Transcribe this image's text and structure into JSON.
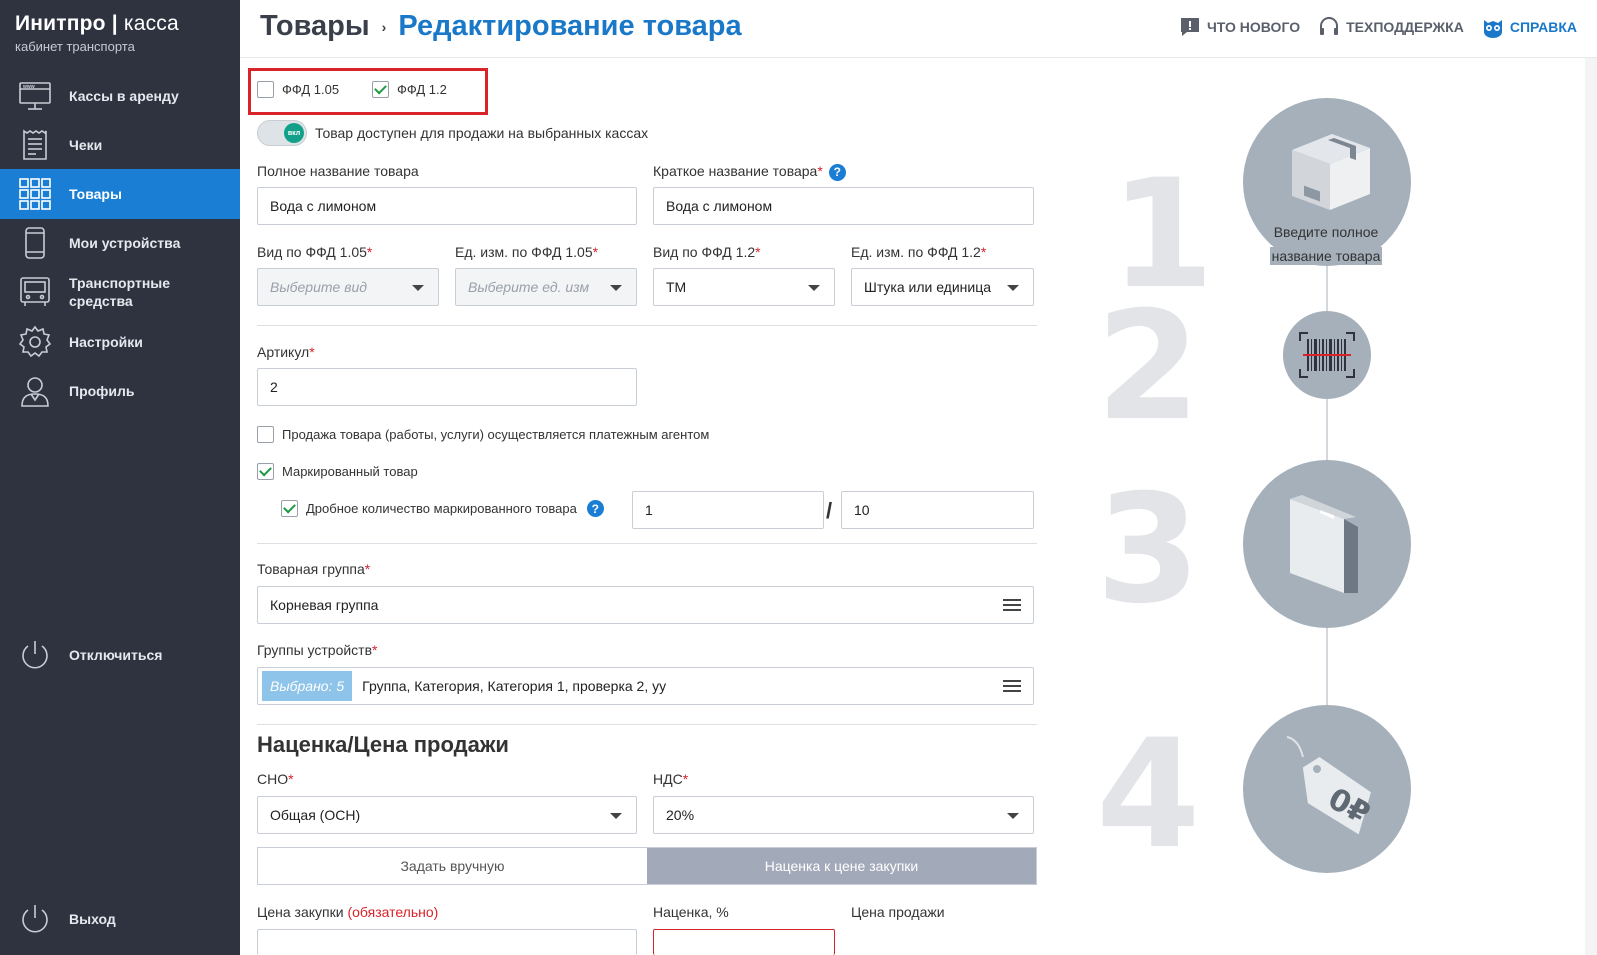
{
  "app": {
    "title_bold": "Инитпро",
    "title_light": "касса",
    "subtitle": "кабинет транспорта"
  },
  "nav": {
    "items": [
      {
        "label": "Кассы в аренду",
        "icon": "www-monitor-icon"
      },
      {
        "label": "Чеки",
        "icon": "receipt-icon"
      },
      {
        "label": "Товары",
        "icon": "grid-icon",
        "active": true
      },
      {
        "label": "Мои устройства",
        "icon": "phone-icon"
      },
      {
        "label": "Транспортные средства",
        "icon": "bus-icon"
      },
      {
        "label": "Настройки",
        "icon": "gear-icon"
      },
      {
        "label": "Профиль",
        "icon": "user-icon"
      }
    ],
    "disconnect": "Отключиться",
    "logout": "Выход"
  },
  "header": {
    "breadcrumb_root": "Товары",
    "breadcrumb_sep": "›",
    "breadcrumb_current": "Редактирование товара",
    "whats_new": "ЧТО НОВОГО",
    "support": "ТЕХПОДДЕРЖКА",
    "help": "СПРАВКА"
  },
  "form": {
    "ffd105_label": "ФФД 1.05",
    "ffd105_checked": false,
    "ffd12_label": "ФФД 1.2",
    "ffd12_checked": true,
    "toggle_knob": "вкл",
    "toggle_label": "Товар доступен для продажи на выбранных кассах",
    "full_name_label": "Полное название товара",
    "full_name_value": "Вода с лимоном",
    "short_name_label": "Краткое название товара",
    "short_name_value": "Вода с лимоном",
    "help_mark": "?",
    "req_mark": "*",
    "ffd105_kind_label": "Вид по ФФД 1.05",
    "ffd105_kind_placeholder": "Выберите вид",
    "ffd105_unit_label": "Ед. изм. по ФФД 1.05",
    "ffd105_unit_placeholder": "Выберите ед. изм",
    "ffd12_kind_label": "Вид по ФФД 1.2",
    "ffd12_kind_value": "ТМ",
    "ffd12_unit_label": "Ед. изм. по ФФД 1.2",
    "ffd12_unit_value": "Штука или единица",
    "article_label": "Артикул",
    "article_value": "2",
    "agent_label": "Продажа товара (работы, услуги) осуществляется платежным агентом",
    "marked_label": "Маркированный товар",
    "fractional_label": "Дробное количество маркированного товара",
    "fraction_numerator": "1",
    "fraction_slash": "/",
    "fraction_denominator": "10",
    "product_group_label": "Товарная группа",
    "product_group_value": "Корневая группа",
    "device_groups_label": "Группы устройств",
    "device_groups_badge": "Выбрано: 5",
    "device_groups_value": "Группа, Категория, Категория 1, проверка 2, уу",
    "markup_section_title": "Наценка/Цена продажи",
    "sno_label": "СНО",
    "sno_value": "Общая (ОСН)",
    "vat_label": "НДС",
    "vat_value": "20%",
    "seg_manual": "Задать вручную",
    "seg_markup": "Наценка к цене закупки",
    "purchase_price_label": "Цена закупки",
    "purchase_price_required": "(обязательно)",
    "markup_label": "Наценка, %",
    "sale_price_label": "Цена продажи"
  },
  "steps": {
    "numbers": [
      "1",
      "2",
      "3",
      "4"
    ],
    "step1_text_line1": "Введите полное",
    "step1_text_line2": "название товара",
    "step4_price": "0₽"
  },
  "colors": {
    "sidebar_bg": "#2f3340",
    "accent": "#1a7fd4",
    "required": "#d9232a",
    "circle": "#a5b0ba"
  }
}
